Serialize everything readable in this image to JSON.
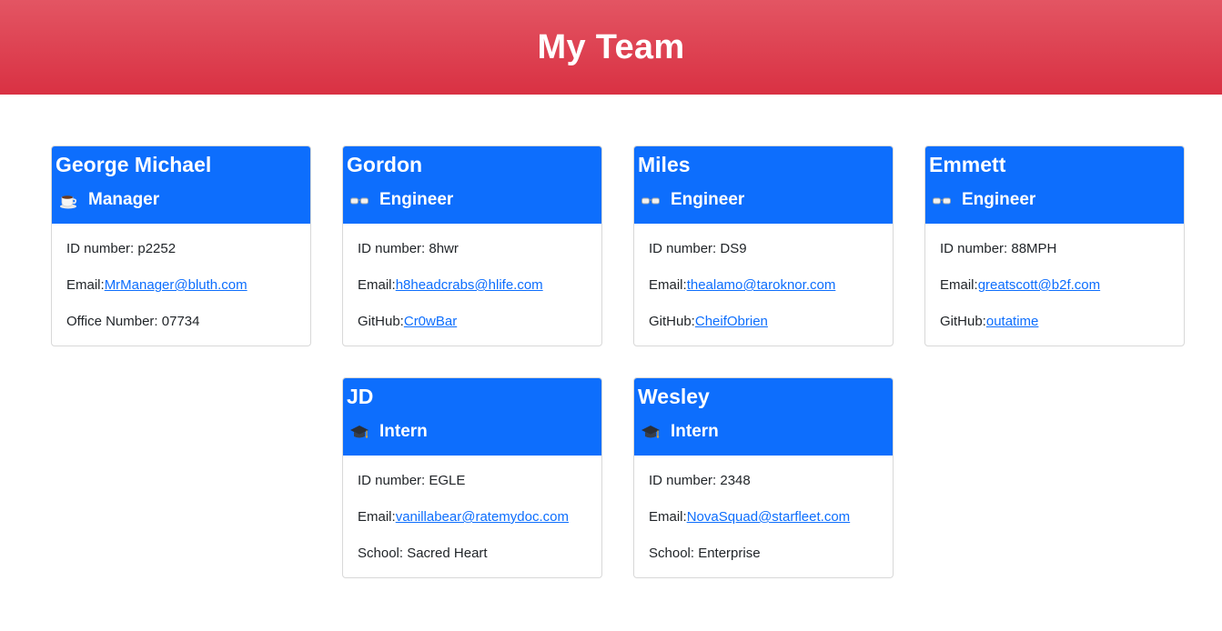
{
  "header": {
    "title": "My Team"
  },
  "cards": [
    {
      "name": "George Michael",
      "role": "Manager",
      "role_icon": "coffee-icon",
      "id_label": "ID number: p2252",
      "email_prefix": "Email:",
      "email": "MrManager@bluth.com",
      "extra_label": "Office Number: 07734",
      "extra_link": ""
    },
    {
      "name": "Gordon",
      "role": "Engineer",
      "role_icon": "glasses-icon",
      "id_label": "ID number: 8hwr",
      "email_prefix": "Email:",
      "email": "h8headcrabs@hlife.com",
      "extra_label": "GitHub:",
      "extra_link": "Cr0wBar"
    },
    {
      "name": "Miles",
      "role": "Engineer",
      "role_icon": "glasses-icon",
      "id_label": "ID number: DS9",
      "email_prefix": "Email:",
      "email": "thealamo@taroknor.com",
      "extra_label": "GitHub:",
      "extra_link": "CheifObrien"
    },
    {
      "name": "Emmett",
      "role": "Engineer",
      "role_icon": "glasses-icon",
      "id_label": "ID number: 88MPH",
      "email_prefix": "Email:",
      "email": "greatscott@b2f.com",
      "extra_label": "GitHub:",
      "extra_link": "outatime"
    },
    {
      "name": "JD",
      "role": "Intern",
      "role_icon": "graduation-cap-icon",
      "id_label": "ID number: EGLE",
      "email_prefix": "Email:",
      "email": "vanillabear@ratemydoc.com",
      "extra_label": "School: Sacred Heart",
      "extra_link": ""
    },
    {
      "name": "Wesley",
      "role": "Intern",
      "role_icon": "graduation-cap-icon",
      "id_label": "ID number: 2348",
      "email_prefix": "Email:",
      "email": "NovaSquad@starfleet.com",
      "extra_label": "School: Enterprise",
      "extra_link": ""
    }
  ],
  "colors": {
    "header_top": "#e35563",
    "header_bottom": "#d93143",
    "card_header": "#0d6efd",
    "link": "#0d6efd"
  }
}
